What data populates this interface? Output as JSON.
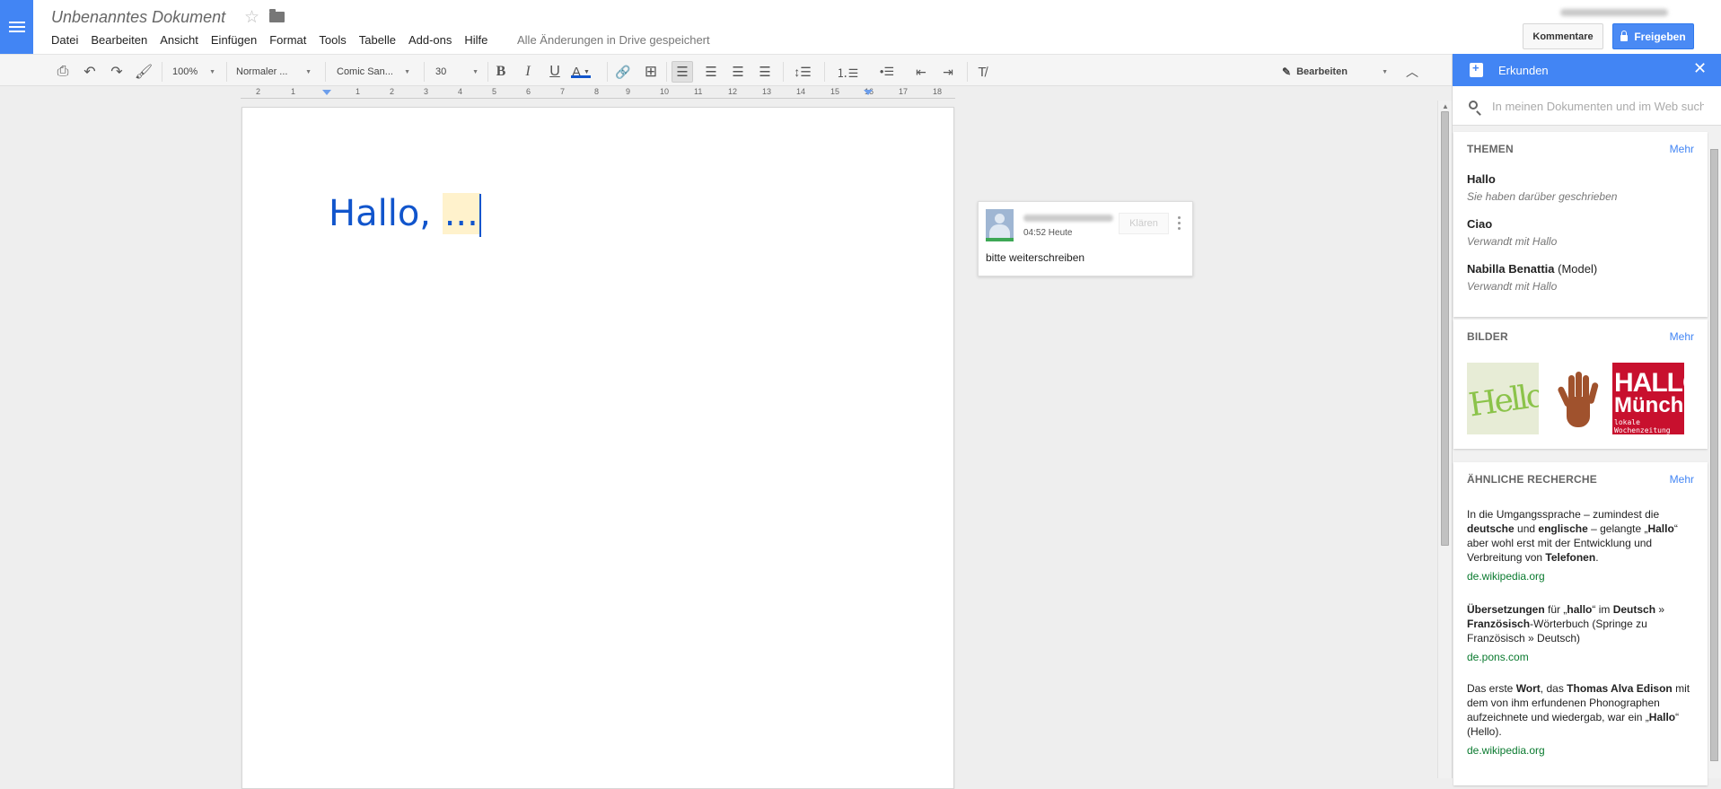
{
  "header": {
    "doc_title": "Unbenanntes Dokument",
    "save_status": "Alle Änderungen in Drive gespeichert",
    "comments_label": "Kommentare",
    "share_label": "Freigeben"
  },
  "menu": [
    "Datei",
    "Bearbeiten",
    "Ansicht",
    "Einfügen",
    "Format",
    "Tools",
    "Tabelle",
    "Add-ons",
    "Hilfe"
  ],
  "toolbar": {
    "zoom": "100%",
    "style": "Normaler ...",
    "font": "Comic San...",
    "font_size": "30",
    "text_color_label": "A",
    "mode_label": "Bearbeiten"
  },
  "ruler": [
    "2",
    "1",
    "1",
    "2",
    "3",
    "4",
    "5",
    "6",
    "7",
    "8",
    "9",
    "10",
    "11",
    "12",
    "13",
    "14",
    "15",
    "16",
    "17",
    "18"
  ],
  "document": {
    "text_before": "Hallo, ",
    "text_highlighted": "..."
  },
  "comment": {
    "time": "04:52 Heute",
    "resolve_label": "Klären",
    "text": "bitte weiterschreiben"
  },
  "explore": {
    "title": "Erkunden",
    "search_placeholder": "In meinen Dokumenten und im Web such",
    "topics_title": "THEMEN",
    "more_label": "Mehr",
    "topics": [
      {
        "name": "Hallo",
        "suffix": "",
        "sub": "Sie haben darüber geschrieben"
      },
      {
        "name": "Ciao",
        "suffix": "",
        "sub": "Verwandt mit Hallo"
      },
      {
        "name": "Nabilla Benattia",
        "suffix": " (Model)",
        "sub": "Verwandt mit Hallo"
      }
    ],
    "images_title": "BILDER",
    "images": [
      {
        "name": "hello-image",
        "text": "Hello"
      },
      {
        "name": "hand-image",
        "text": ""
      },
      {
        "name": "muenchen-image",
        "l1": "HALLO",
        "l2": "München",
        "l3": "lokale Wochenzeitung"
      }
    ],
    "research_title": "ÄHNLICHE RECHERCHE",
    "research": [
      {
        "source": "de.wikipedia.org"
      },
      {
        "source": "de.pons.com"
      },
      {
        "source": "de.wikipedia.org"
      }
    ],
    "research_texts": {
      "r1_a": "In die Umgangssprache – zumindest die ",
      "r1_b": "deutsche",
      "r1_c": " und ",
      "r1_d": "englische",
      "r1_e": " – gelangte „",
      "r1_f": "Hallo",
      "r1_g": "“ aber wohl erst mit der Entwicklung und Verbreitung von ",
      "r1_h": "Telefonen",
      "r1_i": ".",
      "r2_a": "Übersetzungen",
      "r2_b": " für „",
      "r2_c": "hallo",
      "r2_d": "“ im ",
      "r2_e": "Deutsch",
      "r2_f": " » ",
      "r2_g": "Französisch",
      "r2_h": "-Wörterbuch (Springe zu Französisch » Deutsch)",
      "r3_a": "Das erste ",
      "r3_b": "Wort",
      "r3_c": ", das ",
      "r3_d": "Thomas Alva Edison",
      "r3_e": " mit dem von ihm erfundenen Phonographen aufzeichnete und wiedergab, war ein „",
      "r3_f": "Hallo",
      "r3_g": "“ (Hello)."
    }
  }
}
